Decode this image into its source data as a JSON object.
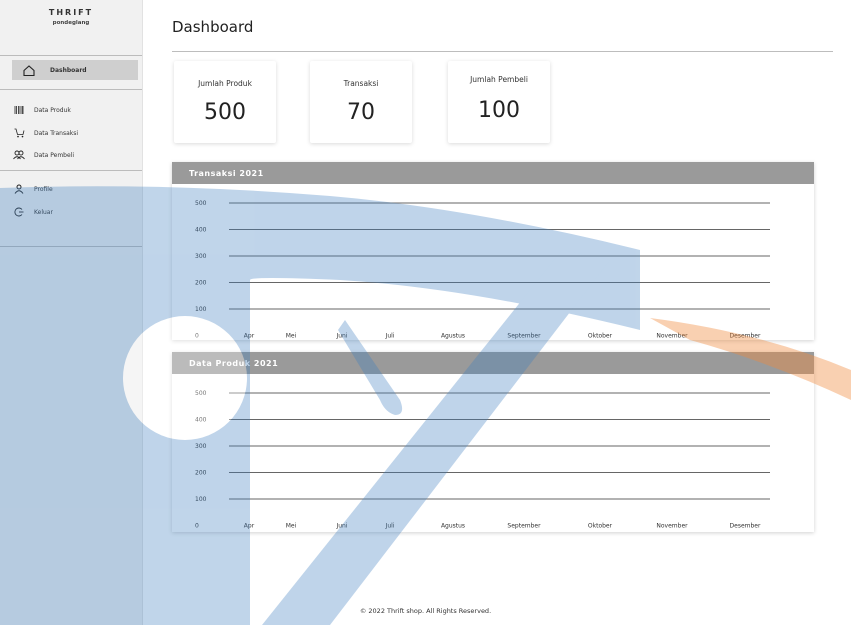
{
  "brand": {
    "title": "THRIFT",
    "subtitle": "pondeglang"
  },
  "sidebar": {
    "items": [
      {
        "label": "Dashboard",
        "icon": "home-icon",
        "active": true
      },
      {
        "label": "Data Produk",
        "icon": "barcode-icon"
      },
      {
        "label": "Data Transaksi",
        "icon": "cart-icon"
      },
      {
        "label": "Data Pembeli",
        "icon": "users-icon"
      },
      {
        "label": "Profile",
        "icon": "user-icon"
      },
      {
        "label": "Keluar",
        "icon": "logout-icon"
      }
    ]
  },
  "header": {
    "title": "Dashboard"
  },
  "stats": [
    {
      "label": "Jumlah Produk",
      "value": "500"
    },
    {
      "label": "Transaksi",
      "value": "70"
    },
    {
      "label": "Jumlah Pembeli",
      "value": "100"
    }
  ],
  "chart_data": [
    {
      "type": "line",
      "title": "Transaksi 2021",
      "y_ticks": [
        "500",
        "400",
        "300",
        "200",
        "100",
        "0"
      ],
      "categories": [
        "Apr",
        "Mei",
        "Juni",
        "Juli",
        "Agustus",
        "September",
        "Oktober",
        "November",
        "Desember"
      ],
      "ylim": [
        0,
        500
      ],
      "grid": true,
      "series": []
    },
    {
      "type": "line",
      "title": "Data Produk 2021",
      "y_ticks": [
        "500",
        "400",
        "300",
        "200",
        "100",
        "0"
      ],
      "categories": [
        "Apr",
        "Mei",
        "Juni",
        "Juli",
        "Agustus",
        "September",
        "Oktober",
        "November",
        "Desember"
      ],
      "ylim": [
        0,
        500
      ],
      "grid": true,
      "series": []
    }
  ],
  "footer": {
    "text": "© 2022 Thrift shop. All Rights Reserved."
  },
  "colors": {
    "sidebar_bg": "#f1f1f1",
    "active_bg": "#cfcfcf",
    "panel_header": "#9a9a9a",
    "watermark_blue": "#3f7fc0",
    "watermark_orange": "#f08a3c"
  }
}
